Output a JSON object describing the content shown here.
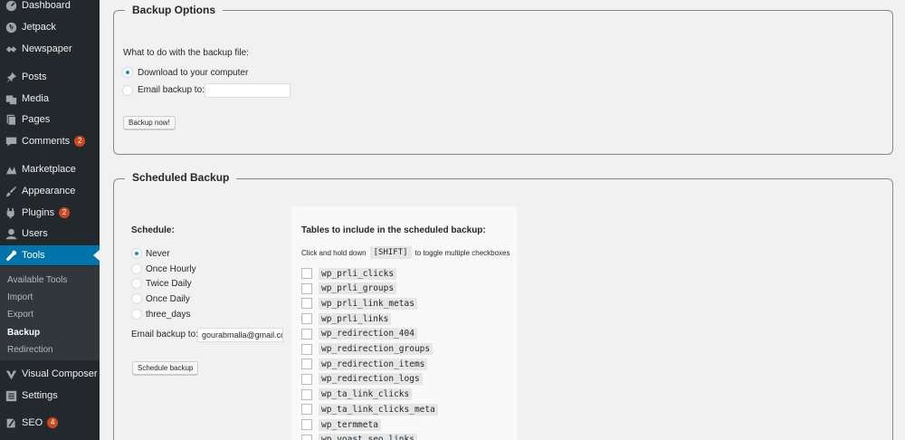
{
  "sidebar": {
    "items": [
      {
        "label": "Dashboard",
        "icon": "dashboard-icon",
        "badge": null
      },
      {
        "label": "Jetpack",
        "icon": "jetpack-icon",
        "badge": null
      },
      {
        "label": "Newspaper",
        "icon": "newspaper-icon",
        "badge": null
      },
      {
        "label": "Posts",
        "icon": "pin-icon",
        "badge": null
      },
      {
        "label": "Media",
        "icon": "media-icon",
        "badge": null
      },
      {
        "label": "Pages",
        "icon": "pages-icon",
        "badge": null
      },
      {
        "label": "Comments",
        "icon": "comment-icon",
        "badge": "2"
      },
      {
        "label": "Marketplace",
        "icon": "marketplace-icon",
        "badge": null
      },
      {
        "label": "Appearance",
        "icon": "brush-icon",
        "badge": null
      },
      {
        "label": "Plugins",
        "icon": "plugin-icon",
        "badge": "2"
      },
      {
        "label": "Users",
        "icon": "user-icon",
        "badge": null
      },
      {
        "label": "Tools",
        "icon": "wrench-icon",
        "badge": null
      },
      {
        "label": "Visual Composer",
        "icon": "visual-composer-icon",
        "badge": null
      },
      {
        "label": "Settings",
        "icon": "settings-icon",
        "badge": null
      },
      {
        "label": "SEO",
        "icon": "seo-icon",
        "badge": "4"
      }
    ],
    "submenu": [
      "Available Tools",
      "Import",
      "Export",
      "Backup",
      "Redirection"
    ],
    "active_color": "#0073aa",
    "background": "#23282d"
  },
  "backup_options": {
    "legend": "Backup Options",
    "question": "What to do with the backup file:",
    "option_download": "Download to your computer",
    "option_email": "Email backup to:",
    "email_value": "",
    "button": "Backup now!"
  },
  "scheduled": {
    "legend": "Scheduled Backup",
    "schedule_label": "Schedule:",
    "options": [
      "Never",
      "Once Hourly",
      "Twice Daily",
      "Once Daily",
      "three_days"
    ],
    "selected": "Never",
    "email_label": "Email backup to:",
    "email_value": "gourabmalla@gmail.com",
    "button": "Schedule backup",
    "tables_heading": "Tables to include in the scheduled backup:",
    "hint_prefix": "Click and hold down",
    "hint_key": "[SHIFT]",
    "hint_suffix": "to toggle multiple checkboxes",
    "tables": [
      "wp_prli_clicks",
      "wp_prli_groups",
      "wp_prli_link_metas",
      "wp_prli_links",
      "wp_redirection_404",
      "wp_redirection_groups",
      "wp_redirection_items",
      "wp_redirection_logs",
      "wp_ta_link_clicks",
      "wp_ta_link_clicks_meta",
      "wp_termmeta",
      "wp_yoast_seo_links"
    ]
  }
}
